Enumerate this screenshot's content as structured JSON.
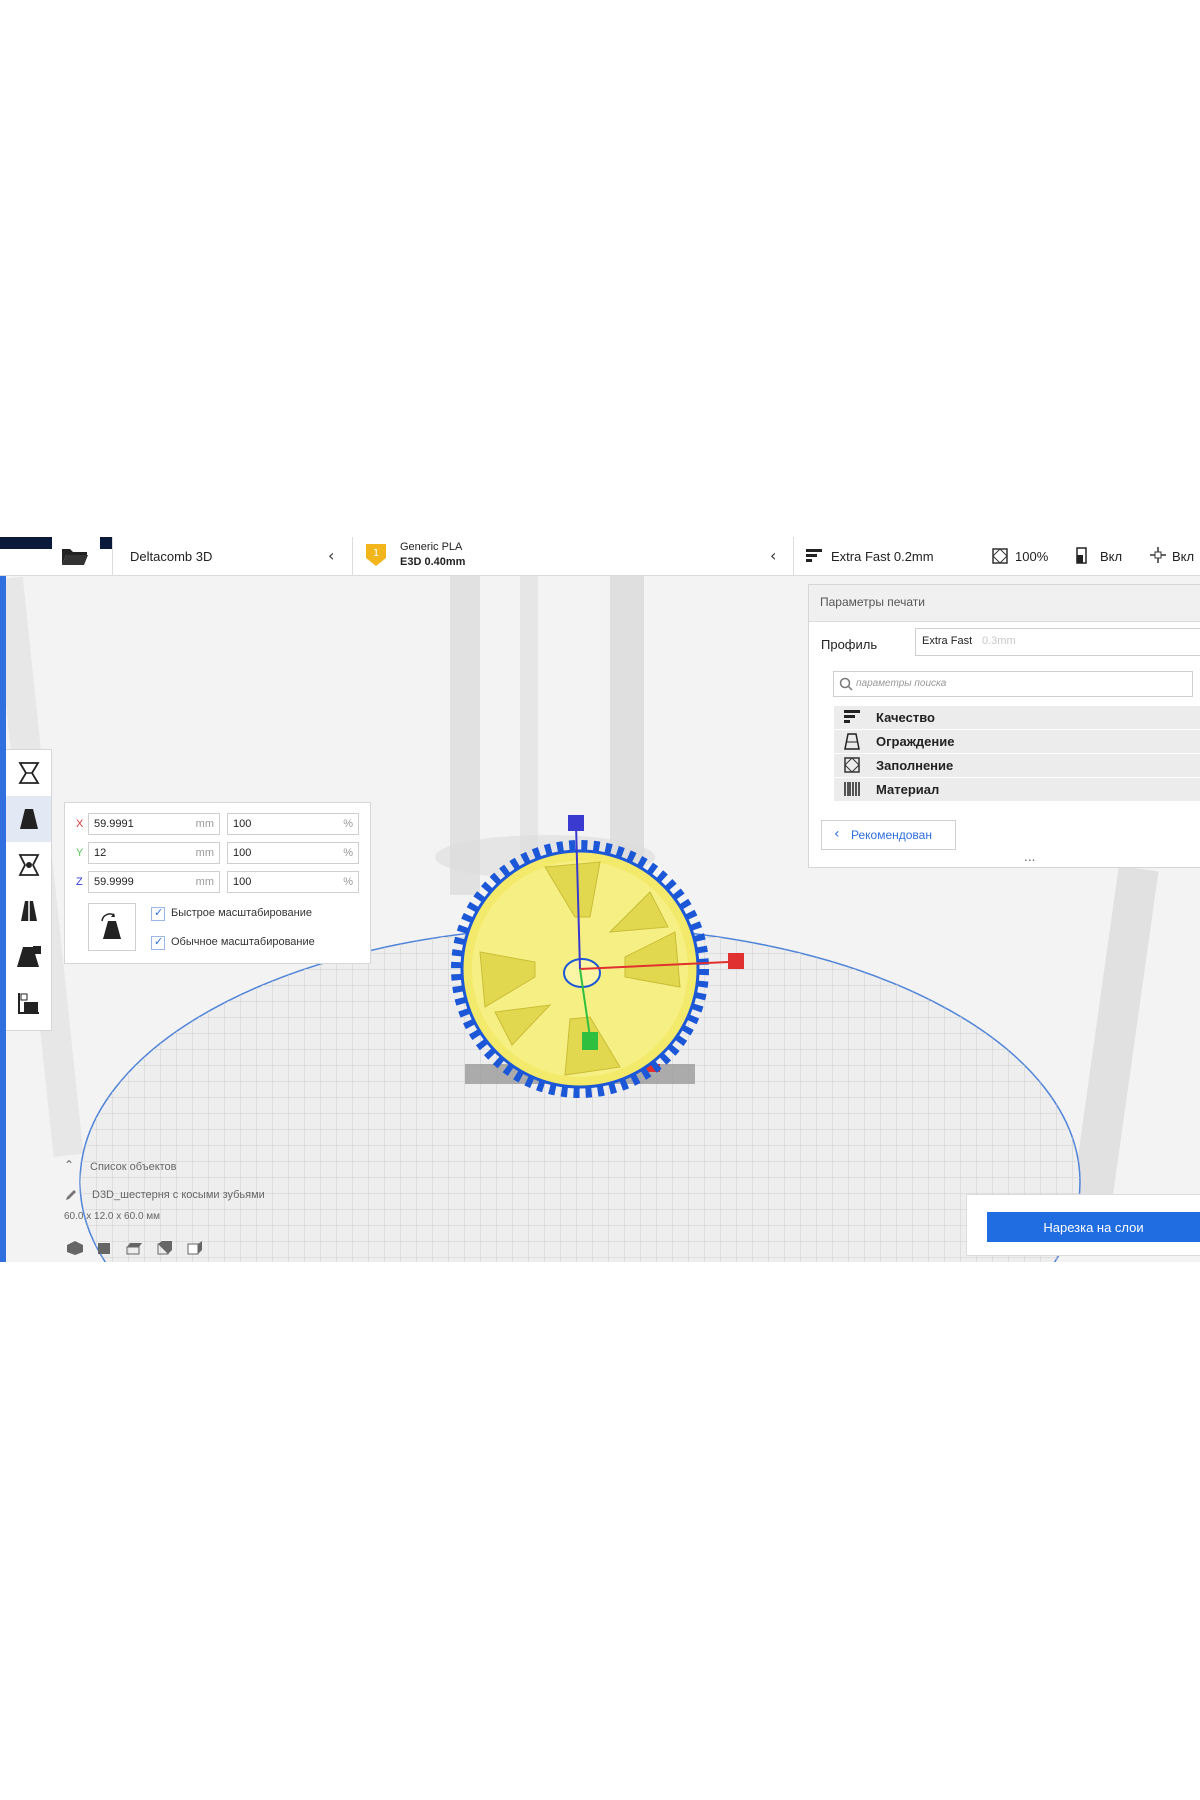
{
  "app": {
    "printer_name": "Deltacomb 3D",
    "material_line1": "Generic PLA",
    "material_line2": "E3D 0.40mm",
    "material_badge": "1",
    "profile_short": "Extra Fast 0.2mm",
    "infill_pct": "100%",
    "support_state": "Вкл",
    "adhesion_state": "Вкл"
  },
  "scale_panel": {
    "rows": [
      {
        "axis": "X",
        "mm": "59.9991",
        "unit_mm": "mm",
        "pct": "100",
        "unit_pct": "%"
      },
      {
        "axis": "Y",
        "mm": "12",
        "unit_mm": "mm",
        "pct": "100",
        "unit_pct": "%"
      },
      {
        "axis": "Z",
        "mm": "59.9999",
        "unit_mm": "mm",
        "pct": "100",
        "unit_pct": "%"
      }
    ],
    "options": [
      {
        "label": "Быстрое масштабирование",
        "checked": true
      },
      {
        "label": "Обычное масштабирование",
        "checked": true
      }
    ]
  },
  "settings_panel": {
    "title": "Параметры печати",
    "profile_label": "Профиль",
    "profile_value": "Extra Fast",
    "profile_hint": "0.3mm",
    "search_placeholder": "параметры поиска",
    "categories": [
      "Качество",
      "Ограждение",
      "Заполнение",
      "Материал"
    ],
    "recommended_button": "Рекомендован",
    "dots": "..."
  },
  "objects": {
    "header": "Список объектов",
    "item_name": "D3D_шестерня с косыми зубьями",
    "dims": "60.0 x 12.0 x 60.0 мм"
  },
  "slice_button": "Нарезка на слои",
  "colors": {
    "accent": "#1f6de1",
    "gear_yellow": "#f3ea6c",
    "outline_blue": "#1b57d6",
    "axis_red": "#e03030",
    "axis_green": "#2fbf3f",
    "axis_blue": "#3a3ad0"
  },
  "icons": [
    "folder-icon",
    "chevron-left-icon",
    "material-badge-icon",
    "quality-icon",
    "infill-icon",
    "support-icon",
    "adhesion-icon",
    "move-tool-icon",
    "scale-tool-icon",
    "rotate-tool-icon",
    "mirror-tool-icon",
    "per-model-settings-icon",
    "support-blocker-icon",
    "search-icon",
    "pencil-icon",
    "chevron-up-icon",
    "view-3d-icon",
    "view-front-icon",
    "view-top-icon",
    "view-left-icon",
    "view-right-icon"
  ]
}
